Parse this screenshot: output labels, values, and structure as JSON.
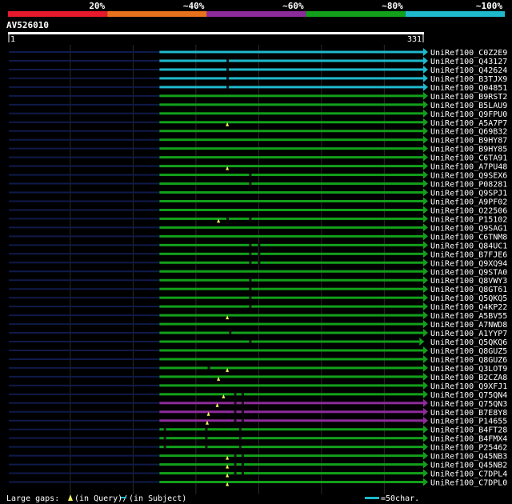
{
  "chart_data": {
    "type": "bar",
    "query_name": "AV526010",
    "query_start": "1",
    "query_end": "331",
    "x_range": [
      1,
      331
    ],
    "identity_scale": [
      {
        "label": "20%",
        "color": "#e8192c"
      },
      {
        "label": "~40%",
        "color": "#e8711c"
      },
      {
        "label": "~60%",
        "color": "#8e2b9a"
      },
      {
        "label": "~80%",
        "color": "#12a01a"
      },
      {
        "label": "~100%",
        "color": "#1eb9cc"
      }
    ],
    "legend": {
      "gaps_label": "Large gaps:",
      "query_gap_text": "(in Query)/",
      "subject_gap_text": "(in Subject)",
      "scale_text": "=50char."
    },
    "hits": [
      {
        "name": "UniRef100_C0Z2E9",
        "identity_class": "~100%",
        "start": 121,
        "end": 331,
        "query_gaps": [],
        "subject_gaps": []
      },
      {
        "name": "UniRef100_Q43127",
        "identity_class": "~100%",
        "start": 121,
        "end": 331,
        "query_gaps": [],
        "subject_gaps": [
          175
        ]
      },
      {
        "name": "UniRef100_Q42624",
        "identity_class": "~100%",
        "start": 121,
        "end": 331,
        "query_gaps": [],
        "subject_gaps": [
          175
        ]
      },
      {
        "name": "UniRef100_B3TJX9",
        "identity_class": "~100%",
        "start": 121,
        "end": 331,
        "query_gaps": [],
        "subject_gaps": [
          175
        ]
      },
      {
        "name": "UniRef100_Q04851",
        "identity_class": "~100%",
        "start": 121,
        "end": 331,
        "query_gaps": [],
        "subject_gaps": [
          175
        ]
      },
      {
        "name": "UniRef100_B9RST2",
        "identity_class": "~80%",
        "start": 121,
        "end": 331,
        "query_gaps": [],
        "subject_gaps": []
      },
      {
        "name": "UniRef100_B5LAU9",
        "identity_class": "~80%",
        "start": 121,
        "end": 331,
        "query_gaps": [],
        "subject_gaps": []
      },
      {
        "name": "UniRef100_Q9FPU0",
        "identity_class": "~80%",
        "start": 121,
        "end": 331,
        "query_gaps": [],
        "subject_gaps": []
      },
      {
        "name": "UniRef100_A5A7P7",
        "identity_class": "~80%",
        "start": 121,
        "end": 331,
        "query_gaps": [
          175
        ],
        "subject_gaps": []
      },
      {
        "name": "UniRef100_Q69B32",
        "identity_class": "~80%",
        "start": 121,
        "end": 331,
        "query_gaps": [],
        "subject_gaps": []
      },
      {
        "name": "UniRef100_B9HY87",
        "identity_class": "~80%",
        "start": 121,
        "end": 331,
        "query_gaps": [],
        "subject_gaps": []
      },
      {
        "name": "UniRef100_B9HY85",
        "identity_class": "~80%",
        "start": 121,
        "end": 331,
        "query_gaps": [],
        "subject_gaps": []
      },
      {
        "name": "UniRef100_C6TA91",
        "identity_class": "~80%",
        "start": 121,
        "end": 331,
        "query_gaps": [],
        "subject_gaps": []
      },
      {
        "name": "UniRef100_A7PU48",
        "identity_class": "~80%",
        "start": 121,
        "end": 331,
        "query_gaps": [
          175
        ],
        "subject_gaps": []
      },
      {
        "name": "UniRef100_Q9SEX6",
        "identity_class": "~80%",
        "start": 121,
        "end": 331,
        "query_gaps": [],
        "subject_gaps": [
          193
        ]
      },
      {
        "name": "UniRef100_P08281",
        "identity_class": "~80%",
        "start": 121,
        "end": 331,
        "query_gaps": [],
        "subject_gaps": [
          193
        ]
      },
      {
        "name": "UniRef100_Q9SPJ1",
        "identity_class": "~80%",
        "start": 121,
        "end": 331,
        "query_gaps": [],
        "subject_gaps": []
      },
      {
        "name": "UniRef100_A9PF02",
        "identity_class": "~80%",
        "start": 121,
        "end": 331,
        "query_gaps": [],
        "subject_gaps": []
      },
      {
        "name": "UniRef100_O22506",
        "identity_class": "~80%",
        "start": 121,
        "end": 331,
        "query_gaps": [],
        "subject_gaps": []
      },
      {
        "name": "UniRef100_P15102",
        "identity_class": "~80%",
        "start": 121,
        "end": 331,
        "query_gaps": [
          168
        ],
        "subject_gaps": [
          175,
          193
        ]
      },
      {
        "name": "UniRef100_Q9SAG1",
        "identity_class": "~80%",
        "start": 121,
        "end": 331,
        "query_gaps": [],
        "subject_gaps": []
      },
      {
        "name": "UniRef100_C6TNM8",
        "identity_class": "~80%",
        "start": 121,
        "end": 331,
        "query_gaps": [],
        "subject_gaps": []
      },
      {
        "name": "UniRef100_Q84UC1",
        "identity_class": "~80%",
        "start": 121,
        "end": 331,
        "query_gaps": [],
        "subject_gaps": [
          193,
          200
        ]
      },
      {
        "name": "UniRef100_B7FJE6",
        "identity_class": "~80%",
        "start": 121,
        "end": 331,
        "query_gaps": [],
        "subject_gaps": [
          193,
          200
        ]
      },
      {
        "name": "UniRef100_Q9XQ94",
        "identity_class": "~80%",
        "start": 121,
        "end": 331,
        "query_gaps": [],
        "subject_gaps": [
          193,
          200
        ]
      },
      {
        "name": "UniRef100_Q9STA0",
        "identity_class": "~80%",
        "start": 121,
        "end": 331,
        "query_gaps": [],
        "subject_gaps": []
      },
      {
        "name": "UniRef100_Q8VWY3",
        "identity_class": "~80%",
        "start": 121,
        "end": 331,
        "query_gaps": [],
        "subject_gaps": [
          193
        ]
      },
      {
        "name": "UniRef100_Q8GT61",
        "identity_class": "~80%",
        "start": 121,
        "end": 331,
        "query_gaps": [],
        "subject_gaps": [
          193
        ]
      },
      {
        "name": "UniRef100_Q5QKQ5",
        "identity_class": "~80%",
        "start": 121,
        "end": 331,
        "query_gaps": [],
        "subject_gaps": [
          193
        ]
      },
      {
        "name": "UniRef100_Q4KP22",
        "identity_class": "~80%",
        "start": 121,
        "end": 331,
        "query_gaps": [],
        "subject_gaps": [
          193
        ]
      },
      {
        "name": "UniRef100_A5BV55",
        "identity_class": "~80%",
        "start": 121,
        "end": 331,
        "query_gaps": [
          175
        ],
        "subject_gaps": []
      },
      {
        "name": "UniRef100_A7NWD8",
        "identity_class": "~80%",
        "start": 121,
        "end": 331,
        "query_gaps": [],
        "subject_gaps": []
      },
      {
        "name": "UniRef100_A1YYP7",
        "identity_class": "~80%",
        "start": 121,
        "end": 331,
        "query_gaps": [],
        "subject_gaps": [
          177
        ]
      },
      {
        "name": "UniRef100_Q5QKQ6",
        "identity_class": "~80%",
        "start": 121,
        "end": 328,
        "query_gaps": [],
        "subject_gaps": [
          193
        ]
      },
      {
        "name": "UniRef100_Q8GUZ5",
        "identity_class": "~80%",
        "start": 121,
        "end": 331,
        "query_gaps": [],
        "subject_gaps": []
      },
      {
        "name": "UniRef100_Q8GUZ6",
        "identity_class": "~80%",
        "start": 121,
        "end": 331,
        "query_gaps": [],
        "subject_gaps": []
      },
      {
        "name": "UniRef100_Q3LOT9",
        "identity_class": "~80%",
        "start": 121,
        "end": 331,
        "query_gaps": [
          175
        ],
        "subject_gaps": [
          160
        ]
      },
      {
        "name": "UniRef100_B2CZA8",
        "identity_class": "~80%",
        "start": 121,
        "end": 331,
        "query_gaps": [
          168
        ],
        "subject_gaps": []
      },
      {
        "name": "UniRef100_Q9XFJ1",
        "identity_class": "~80%",
        "start": 121,
        "end": 331,
        "query_gaps": [],
        "subject_gaps": []
      },
      {
        "name": "UniRef100_Q75QN4",
        "identity_class": "~80%",
        "start": 121,
        "end": 331,
        "query_gaps": [
          172
        ],
        "subject_gaps": [
          181,
          187
        ]
      },
      {
        "name": "UniRef100_Q75QN3",
        "identity_class": "~60%",
        "start": 121,
        "end": 331,
        "query_gaps": [
          167
        ],
        "subject_gaps": [
          181,
          187
        ]
      },
      {
        "name": "UniRef100_B7E8Y8",
        "identity_class": "~60%",
        "start": 121,
        "end": 331,
        "query_gaps": [
          160
        ],
        "subject_gaps": [
          181,
          187
        ]
      },
      {
        "name": "UniRef100_P14655",
        "identity_class": "~60%",
        "start": 121,
        "end": 331,
        "query_gaps": [
          159
        ],
        "subject_gaps": [
          181,
          187
        ]
      },
      {
        "name": "UniRef100_B4FT28",
        "identity_class": "~80%",
        "start": 121,
        "end": 331,
        "query_gaps": [],
        "subject_gaps": [
          125,
          158,
          185
        ]
      },
      {
        "name": "UniRef100_B4FMX4",
        "identity_class": "~80%",
        "start": 121,
        "end": 331,
        "query_gaps": [],
        "subject_gaps": [
          125,
          158,
          185
        ]
      },
      {
        "name": "UniRef100_P25462",
        "identity_class": "~80%",
        "start": 121,
        "end": 331,
        "query_gaps": [],
        "subject_gaps": [
          125,
          158,
          185
        ]
      },
      {
        "name": "UniRef100_Q45NB3",
        "identity_class": "~80%",
        "start": 121,
        "end": 331,
        "query_gaps": [
          175
        ],
        "subject_gaps": [
          181,
          187
        ]
      },
      {
        "name": "UniRef100_Q45NB2",
        "identity_class": "~80%",
        "start": 121,
        "end": 331,
        "query_gaps": [
          175
        ],
        "subject_gaps": [
          181,
          187
        ]
      },
      {
        "name": "UniRef100_C7DPL4",
        "identity_class": "~80%",
        "start": 121,
        "end": 331,
        "query_gaps": [
          175
        ],
        "subject_gaps": [
          181,
          187
        ]
      },
      {
        "name": "UniRef100_C7DPL0",
        "identity_class": "~80%",
        "start": 121,
        "end": 331,
        "query_gaps": [
          175
        ],
        "subject_gaps": []
      }
    ]
  }
}
